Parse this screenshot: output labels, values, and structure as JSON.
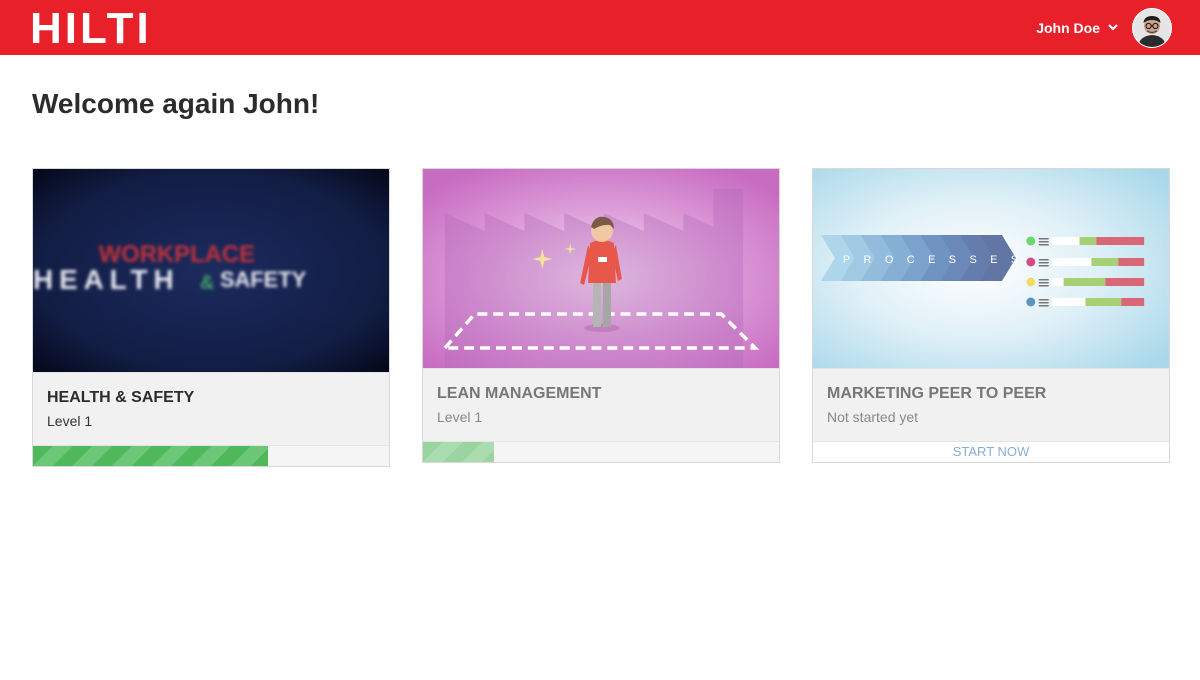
{
  "header": {
    "brand": "HILTI",
    "user_name": "John Doe",
    "accent_color": "#e8202a",
    "icons": [
      "chevron-down-icon",
      "avatar"
    ]
  },
  "welcome": "Welcome again John!",
  "courses": [
    {
      "title": "HEALTH & SAFETY",
      "subtitle": "Level 1",
      "thumb_text_top": "WORKPLACE",
      "thumb_text_main": "HEALTH",
      "thumb_text_amp": "&",
      "thumb_text_end": "SAFETY",
      "progress": 0.66
    },
    {
      "title": "LEAN MANAGEMENT",
      "subtitle": "Level 1",
      "progress": 0.2
    },
    {
      "title": "MARKETING PEER TO PEER",
      "subtitle": "Not started yet",
      "action": "START NOW",
      "thumb_text": "PROCESSES"
    }
  ],
  "colors": {
    "progress": "#4fb85a",
    "start_link": "#89aed0"
  }
}
